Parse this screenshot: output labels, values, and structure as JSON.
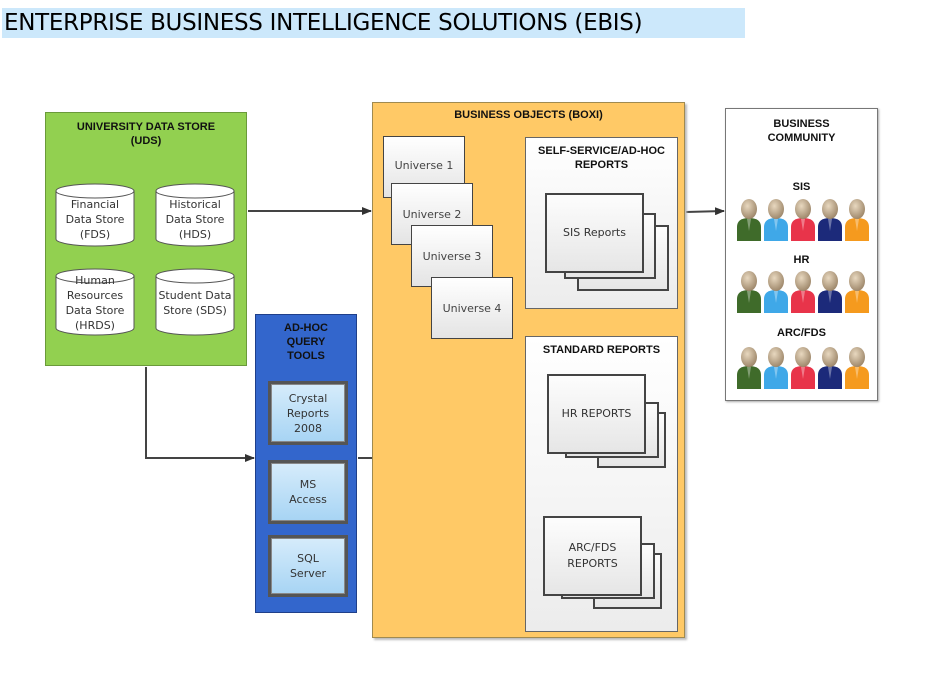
{
  "title": "ENTERPRISE BUSINESS INTELLIGENCE SOLUTIONS (EBIS)",
  "uds": {
    "title_line1": "UNIVERSITY DATA STORE",
    "title_line2": "(UDS)",
    "color": "#92d050",
    "stores": [
      {
        "lines": [
          "Financial",
          "Data Store",
          "(FDS)"
        ]
      },
      {
        "lines": [
          "Historical",
          "Data Store",
          "(HDS)"
        ]
      },
      {
        "lines": [
          "Human",
          "Resources",
          "Data Store",
          "(HRDS)"
        ]
      },
      {
        "lines": [
          "Student Data",
          "Store (SDS)"
        ]
      }
    ]
  },
  "adhoc": {
    "title_lines": [
      "AD-HOC",
      "QUERY",
      "TOOLS"
    ],
    "color": "#3366cc",
    "tools": [
      {
        "lines": [
          "Crystal",
          "Reports",
          "2008"
        ]
      },
      {
        "lines": [
          "MS",
          "Access"
        ]
      },
      {
        "lines": [
          "SQL",
          "Server"
        ]
      }
    ]
  },
  "boxi": {
    "title": "BUSINESS OBJECTS (BOXI)",
    "color": "#ffc966",
    "universes": [
      "Universe 1",
      "Universe 2",
      "Universe 3",
      "Universe 4"
    ],
    "self_service": {
      "title_line1": "SELF-SERVICE/AD-HOC",
      "title_line2": "REPORTS",
      "reports": [
        {
          "lines": [
            "SIS Reports"
          ]
        }
      ]
    },
    "standard": {
      "title": "STANDARD REPORTS",
      "reports": [
        {
          "lines": [
            "HR REPORTS"
          ]
        },
        {
          "lines": [
            "ARC/FDS",
            "REPORTS"
          ]
        }
      ]
    }
  },
  "community": {
    "title_line1": "BUSINESS",
    "title_line2": "COMMUNITY",
    "groups": [
      {
        "label": "SIS",
        "people_count": 5
      },
      {
        "label": "HR",
        "people_count": 5
      },
      {
        "label": "ARC/FDS",
        "people_count": 5
      }
    ],
    "shirt_colors": [
      "#3f6b2a",
      "#3fa8e8",
      "#e8344a",
      "#1c2a7a",
      "#f59a1e"
    ]
  },
  "connections": [
    {
      "from": "uds",
      "to": "boxi"
    },
    {
      "from": "uds",
      "to": "adhoc-query-tools"
    },
    {
      "from": "adhoc-query-tools",
      "to": "standard-reports"
    },
    {
      "from": "universe-1",
      "to": "self-service-reports"
    },
    {
      "from": "universe-4",
      "to": "standard-reports"
    },
    {
      "from": "boxi",
      "to": "business-community"
    }
  ]
}
